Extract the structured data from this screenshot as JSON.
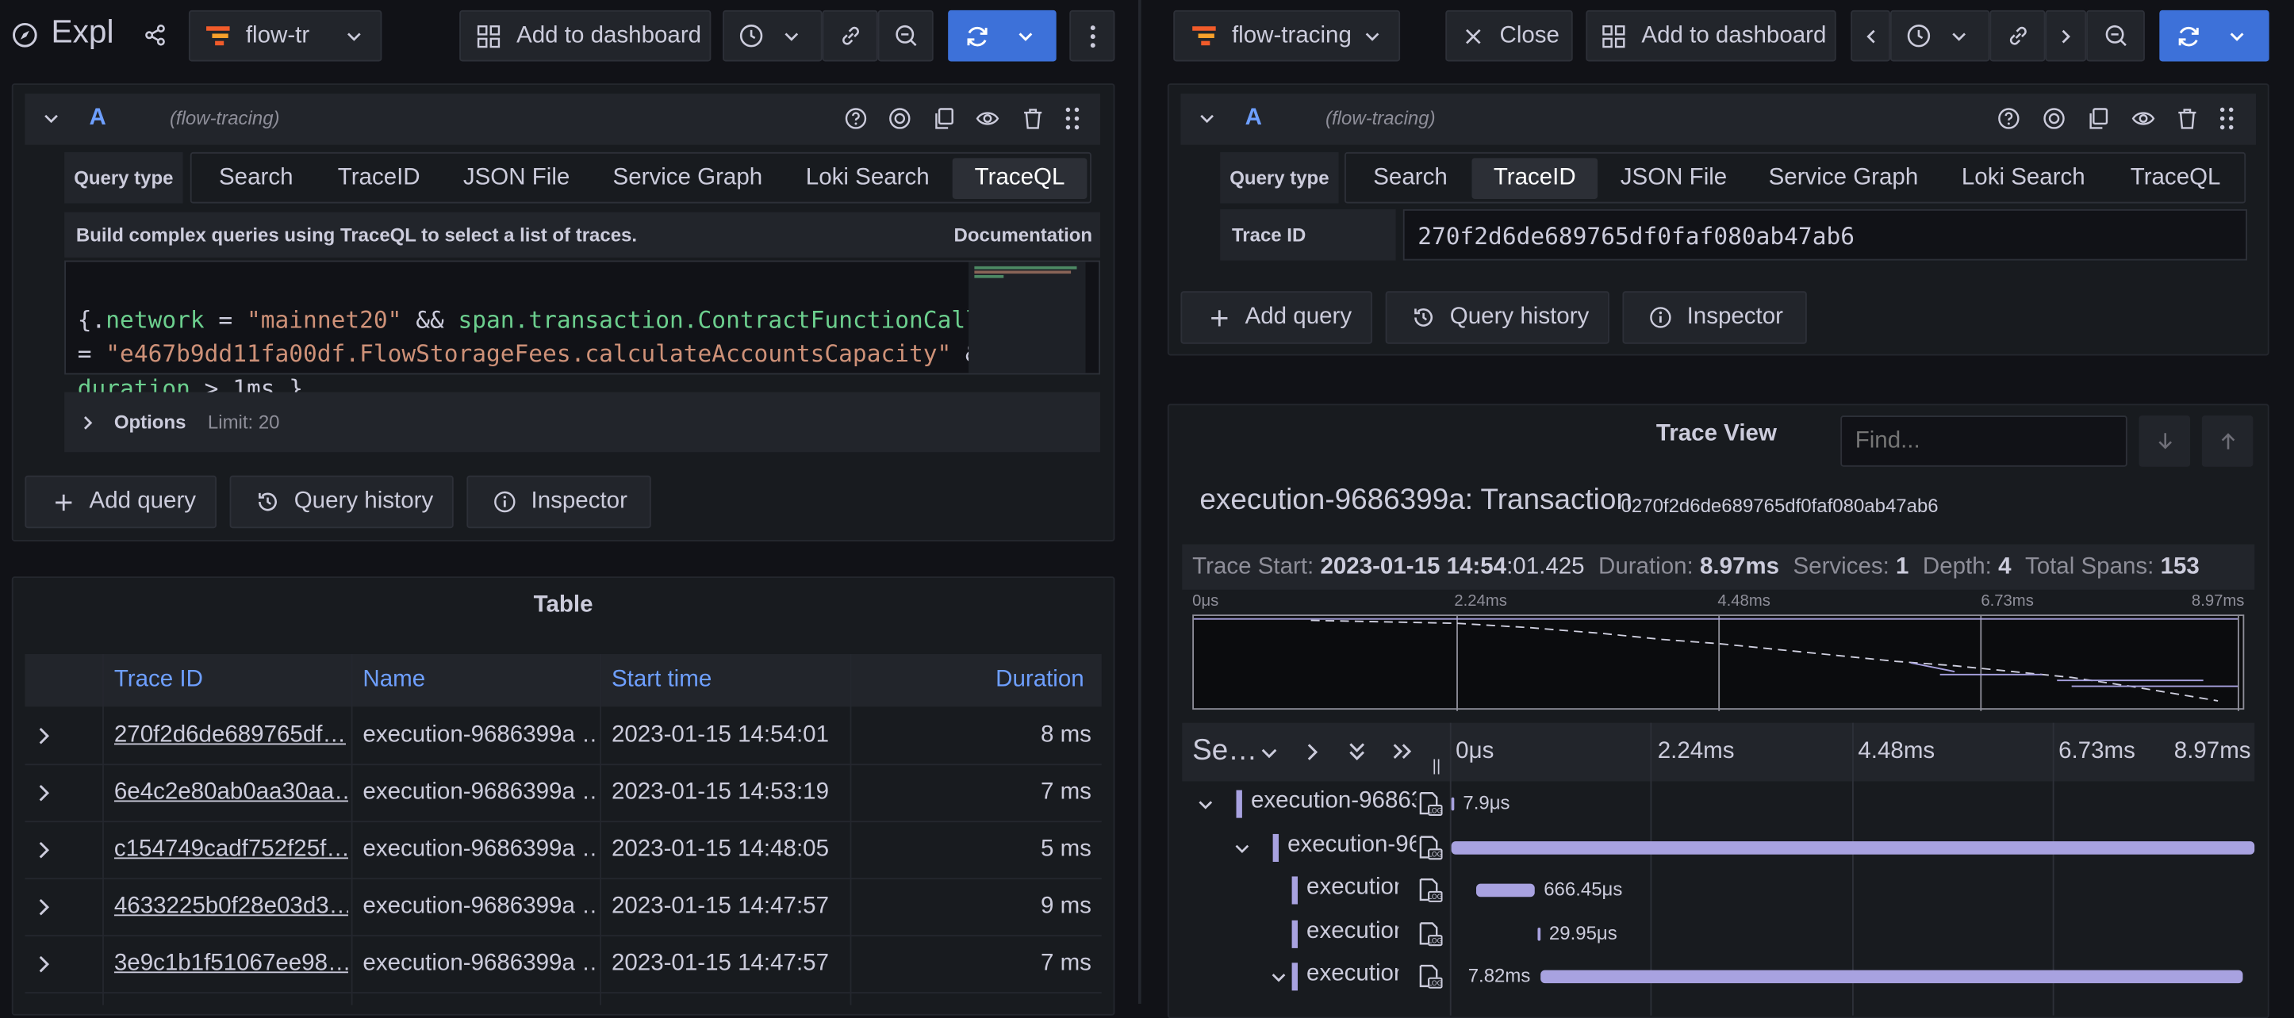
{
  "left": {
    "explore_title": "Expl",
    "datasource": "flow-tr",
    "add_to_dashboard": "Add to dashboard",
    "query": {
      "letter": "A",
      "ds_label": "(flow-tracing)",
      "query_type_label": "Query type",
      "tabs": [
        "Search",
        "TraceID",
        "JSON File",
        "Service Graph",
        "Loki Search",
        "TraceQL"
      ],
      "active_tab": "TraceQL",
      "help_text": "Build complex queries using TraceQL to select a list of traces.",
      "documentation": "Documentation",
      "code": {
        "line1_open": "{.",
        "line1_attr": "network",
        "line1_eq": " = ",
        "line1_str": "\"mainnet20\"",
        "line1_and": " && ",
        "line1_span": "span.transaction.ContractFunctionCall",
        "line2_eq": "= ",
        "line2_str": "\"e467b9dd11fa00df.FlowStorageFees.calculateAccountsCapacity\"",
        "line2_and": " &&",
        "line3_kw": "duration",
        "line3_rest": " > 1ms }"
      },
      "options_label": "Options",
      "options_limit": "Limit: 20"
    },
    "add_query": "Add query",
    "query_history": "Query history",
    "inspector": "Inspector",
    "table": {
      "title": "Table",
      "columns": [
        "Trace ID",
        "Name",
        "Start time",
        "Duration"
      ],
      "rows": [
        {
          "trace_id": "270f2d6de689765df…",
          "name": "execution-9686399a …",
          "start": "2023-01-15 14:54:01",
          "duration": "8 ms"
        },
        {
          "trace_id": "6e4c2e80ab0aa30aa…",
          "name": "execution-9686399a …",
          "start": "2023-01-15 14:53:19",
          "duration": "7 ms"
        },
        {
          "trace_id": "c154749cadf752f25f…",
          "name": "execution-9686399a …",
          "start": "2023-01-15 14:48:05",
          "duration": "5 ms"
        },
        {
          "trace_id": "4633225b0f28e03d3…",
          "name": "execution-9686399a …",
          "start": "2023-01-15 14:47:57",
          "duration": "9 ms"
        },
        {
          "trace_id": "3e9c1b1f51067ee98…",
          "name": "execution-9686399a …",
          "start": "2023-01-15 14:47:57",
          "duration": "7 ms"
        }
      ]
    }
  },
  "right": {
    "datasource": "flow-tracing",
    "close": "Close",
    "add_to_dashboard": "Add to dashboard",
    "query": {
      "letter": "A",
      "ds_label": "(flow-tracing)",
      "query_type_label": "Query type",
      "tabs": [
        "Search",
        "TraceID",
        "JSON File",
        "Service Graph",
        "Loki Search",
        "TraceQL"
      ],
      "active_tab": "TraceID",
      "trace_id_label": "Trace ID",
      "trace_id_value": "270f2d6de689765df0faf080ab47ab6"
    },
    "add_query": "Add query",
    "query_history": "Query history",
    "inspector": "Inspector",
    "trace": {
      "view_title": "Trace View",
      "find_placeholder": "Find...",
      "name": "execution-9686399a: Transaction",
      "trace_id": "0270f2d6de689765df0faf080ab47ab6",
      "start_label": "Trace Start:",
      "start_value_bold": "2023-01-15 14:54",
      "start_value_rest": ":01.425",
      "duration_label": "Duration:",
      "duration_value": "8.97ms",
      "services_label": "Services:",
      "services_value": "1",
      "depth_label": "Depth:",
      "depth_value": "4",
      "total_spans_label": "Total Spans:",
      "total_spans_value": "153",
      "minimap_ticks": [
        "0μs",
        "2.24ms",
        "4.48ms",
        "6.73ms",
        "8.97ms"
      ],
      "header_service": "Se…",
      "ticks": [
        "0μs",
        "2.24ms",
        "4.48ms",
        "6.73ms",
        "8.97ms"
      ],
      "spans": [
        {
          "label": "execution-96863",
          "duration": "7.9μs",
          "depth": 0,
          "expanded": true,
          "start": 0.0,
          "width": 0.0009
        },
        {
          "label": "execution-96",
          "duration": "",
          "depth": 1,
          "expanded": true,
          "start": 0.0009,
          "width": 0.998
        },
        {
          "label": "execution",
          "duration": "666.45μs",
          "depth": 2,
          "expanded": null,
          "start": 0.03,
          "width": 0.074
        },
        {
          "label": "execution",
          "duration": "29.95μs",
          "depth": 2,
          "expanded": null,
          "start": 0.107,
          "width": 0.0033
        },
        {
          "label": "execution",
          "duration": "7.82ms",
          "depth": 2,
          "expanded": true,
          "start": 0.111,
          "width": 0.872
        }
      ],
      "accent": "#a8a2e0"
    }
  }
}
